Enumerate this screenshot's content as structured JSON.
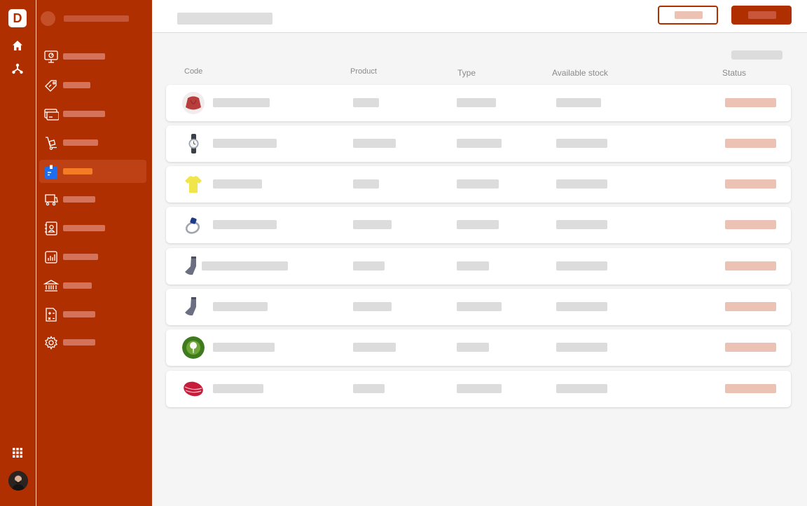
{
  "brand": {
    "logo_letter": "D",
    "accent": "#b02f00",
    "active_accent": "#f47c26"
  },
  "rail": {
    "icons": [
      "home-icon",
      "network-icon",
      "apps-grid-icon"
    ]
  },
  "sidebar": {
    "items": [
      {
        "icon": "dashboard-monitor-icon",
        "label": ""
      },
      {
        "icon": "tag-icon",
        "label": ""
      },
      {
        "icon": "card-icon",
        "label": ""
      },
      {
        "icon": "hand-truck-icon",
        "label": ""
      },
      {
        "icon": "inventory-icon",
        "label": "",
        "active": true
      },
      {
        "icon": "cart-icon",
        "label": ""
      },
      {
        "icon": "contacts-icon",
        "label": ""
      },
      {
        "icon": "reports-icon",
        "label": ""
      },
      {
        "icon": "bank-icon",
        "label": ""
      },
      {
        "icon": "calculator-icon",
        "label": ""
      },
      {
        "icon": "settings-icon",
        "label": ""
      }
    ]
  },
  "header": {
    "title": "",
    "secondary_button": "",
    "primary_button": ""
  },
  "table": {
    "columns": [
      "Code",
      "Product",
      "Type",
      "Available stock",
      "Status"
    ],
    "rows": [
      {
        "image": "red-sweater",
        "code": "",
        "product": "",
        "type": "",
        "stock": "",
        "status": ""
      },
      {
        "image": "wristwatch",
        "code": "",
        "product": "",
        "type": "",
        "stock": "",
        "status": ""
      },
      {
        "image": "yellow-tshirt",
        "code": "",
        "product": "",
        "type": "",
        "stock": "",
        "status": ""
      },
      {
        "image": "sapphire-ring",
        "code": "",
        "product": "",
        "type": "",
        "stock": "",
        "status": ""
      },
      {
        "image": "gray-sock",
        "code": "",
        "product": "",
        "type": "",
        "stock": "",
        "status": ""
      },
      {
        "image": "gray-sock",
        "code": "",
        "product": "",
        "type": "",
        "stock": "",
        "status": ""
      },
      {
        "image": "golf-ball",
        "code": "",
        "product": "",
        "type": "",
        "stock": "",
        "status": ""
      },
      {
        "image": "red-ribbon",
        "code": "",
        "product": "",
        "type": "",
        "stock": "",
        "status": ""
      }
    ]
  }
}
